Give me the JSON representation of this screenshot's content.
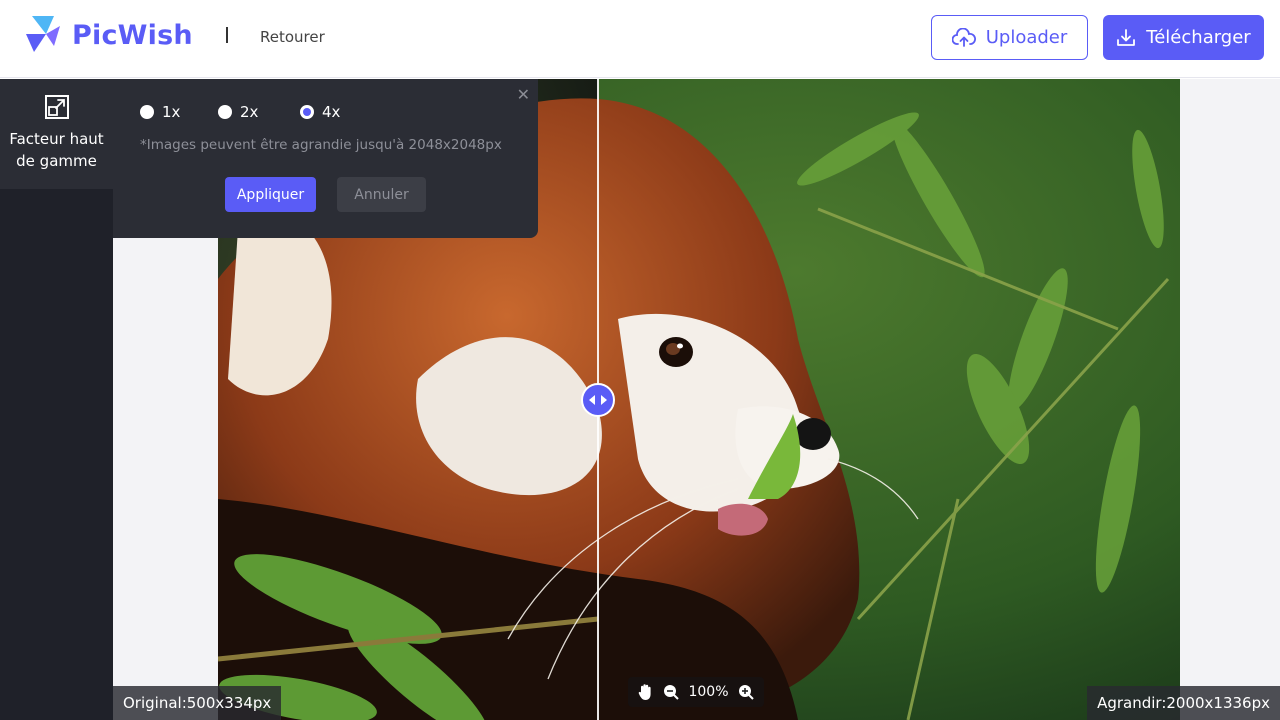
{
  "header": {
    "brand": "PicWish",
    "back_label": "Retourer",
    "upload_label": "Uploader",
    "download_label": "Télécharger"
  },
  "sidebar": {
    "tool_label_line1": "Facteur haut",
    "tool_label_line2": "de gamme"
  },
  "popup": {
    "options": [
      "1x",
      "2x",
      "4x"
    ],
    "selected": "4x",
    "note": "*Images peuvent être agrandie jusqu'à 2048x2048px",
    "apply_label": "Appliquer",
    "cancel_label": "Annuler"
  },
  "canvas": {
    "original_label": "Original:500x334px",
    "enlarged_label": "Agrandir:2000x1336px",
    "zoom": "100%"
  },
  "colors": {
    "accent": "#5a5cf6",
    "sidebar": "#1f2129",
    "panel": "#2b2d35"
  },
  "icons": [
    "picwish-logo",
    "cloud-upload-icon",
    "download-icon",
    "upscale-icon",
    "close-icon",
    "compare-handle-icon",
    "hand-icon",
    "zoom-out-icon",
    "zoom-in-icon"
  ]
}
